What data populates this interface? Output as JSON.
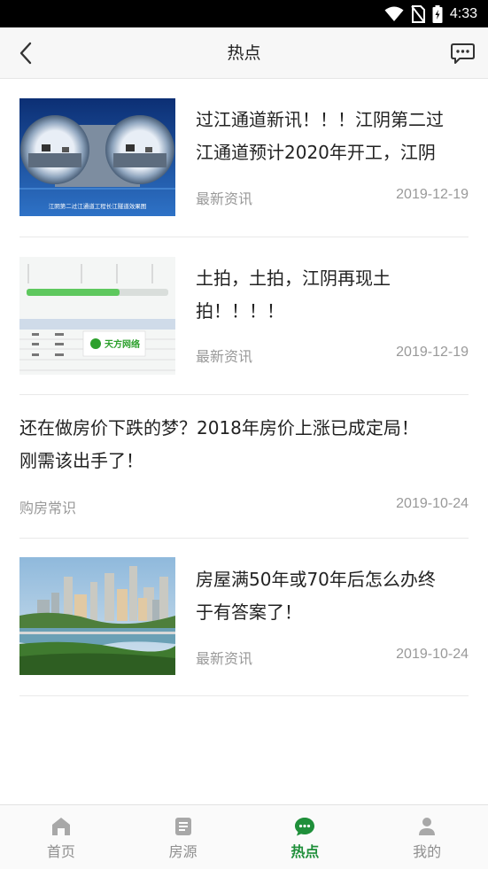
{
  "status_bar": {
    "time": "4:33",
    "icons": [
      "wifi-icon",
      "no-sim-icon",
      "battery-icon"
    ]
  },
  "header": {
    "title": "热点",
    "back_icon": "chevron-left-icon",
    "message_icon": "message-dots-icon"
  },
  "articles": [
    {
      "title_line1": "过江通道新讯！！！江阴第二过",
      "title_line2": "江通道预计2020年开工，江阴",
      "category": "最新资讯",
      "date": "2019-12-19",
      "thumbnail": "tunnel-rendering",
      "thumb_caption": "江阴第二过江通道工程长江隧道效果图"
    },
    {
      "title_line1": "土拍，土拍，江阴再现土",
      "title_line2": "拍！！！！",
      "category": "最新资讯",
      "date": "2019-12-19",
      "thumbnail": "land-auction-table",
      "thumb_brand": "天方网络"
    },
    {
      "title_line1": "还在做房价下跌的梦？2018年房价上涨已成定局！",
      "title_line2": "刚需该出手了！",
      "category": "购房常识",
      "date": "2019-10-24"
    },
    {
      "title_line1": "房屋满50年或70年后怎么办终",
      "title_line2": "于有答案了！",
      "category": "最新资讯",
      "date": "2019-10-24",
      "thumbnail": "city-river-skyline"
    }
  ],
  "tabs": [
    {
      "label": "首页",
      "icon": "home-icon",
      "active": false
    },
    {
      "label": "房源",
      "icon": "document-icon",
      "active": false
    },
    {
      "label": "热点",
      "icon": "chat-bubble-icon",
      "active": true
    },
    {
      "label": "我的",
      "icon": "user-icon",
      "active": false
    }
  ],
  "colors": {
    "accent": "#1f8f3a",
    "inactive": "#8f8f8f",
    "meta_text": "#999999",
    "status_bar": "#000000"
  }
}
